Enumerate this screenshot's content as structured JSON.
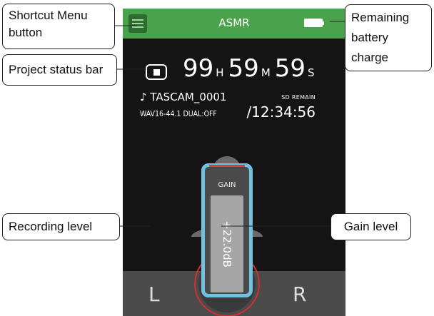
{
  "screen": {
    "title": "ASMR",
    "timecode": {
      "hours": "99",
      "hours_unit": "H",
      "minutes": "59",
      "minutes_unit": "M",
      "seconds": "59",
      "seconds_unit": "S"
    },
    "file_name": "TASCAM_0001",
    "file_icon": "music-note-icon",
    "format": "WAV16-44.1 DUAL:OFF",
    "sd_label": "SD REMAIN",
    "remaining_time": "/12:34:56",
    "gain_label": "GAIN",
    "gain_value": "+22.0dB",
    "left_channel": "L",
    "right_channel": "R",
    "battery_level": 1.0
  },
  "callouts": {
    "shortcut_menu": "Shortcut Menu button",
    "project_status": "Project status bar",
    "recording_level": "Recording level",
    "remaining_battery": "Remaining battery charge",
    "gain_level": "Gain level"
  },
  "colors": {
    "topbar": "#4aa24c",
    "screen_bg": "#141414",
    "meter_active_low": "#8bc34a",
    "meter_active_high": "#2e9a4a",
    "meter_inactive": "#555555",
    "gain_border": "#73c0e0",
    "record_ring": "#d03030",
    "peak_indicator": "#d04040"
  }
}
